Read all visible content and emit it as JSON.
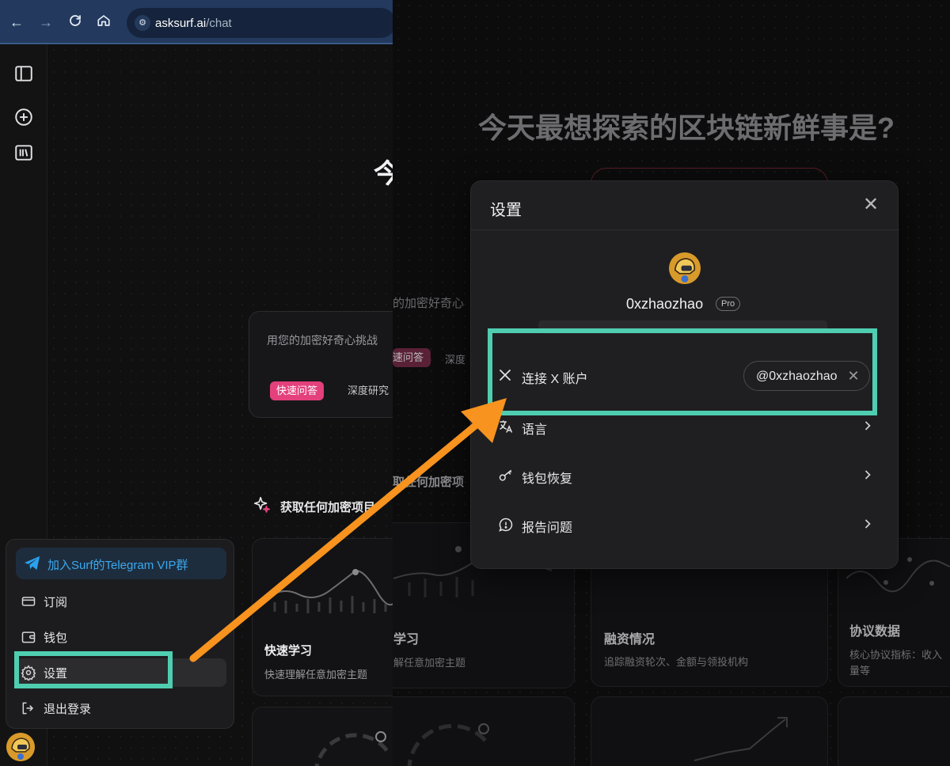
{
  "browser": {
    "url_host": "asksurf.ai",
    "url_path": "/chat"
  },
  "left": {
    "title_partial": "今",
    "chat_placeholder": "用您的加密好奇心挑战",
    "modes": {
      "fast": "快速问答",
      "deep": "深度研究"
    },
    "explore_heading": "获取任何加密项目",
    "cards": [
      {
        "title": "快速学习",
        "desc": "快速理解任意加密主题"
      }
    ],
    "menu": {
      "telegram": "加入Surf的Telegram VIP群",
      "items": [
        {
          "label": "订阅",
          "icon": "card-icon"
        },
        {
          "label": "钱包",
          "icon": "wallet-icon"
        },
        {
          "label": "设置",
          "icon": "gear-icon"
        },
        {
          "label": "退出登录",
          "icon": "logout-icon"
        }
      ]
    }
  },
  "right": {
    "page_title": "今天最想探索的区块链新鲜事是?",
    "chat_placeholder": "的加密好奇心",
    "modes": {
      "fast": "速问答",
      "deep": "深度"
    },
    "explore_heading": "取任何加密项",
    "cards": [
      {
        "title": "学习",
        "desc": "解任意加密主题"
      },
      {
        "title": "融资情况",
        "desc": "追踪融资轮次、金额与领投机构"
      },
      {
        "title": "协议数据",
        "desc": "核心协议指标：收入",
        "desc2": "量等"
      }
    ],
    "modal": {
      "title": "设置",
      "username": "0xzhaozhao",
      "badge": "Pro",
      "rows": [
        {
          "label": "连接 X 账户",
          "icon": "x-logo-icon",
          "value": "@0xzhaozhao"
        },
        {
          "label": "语言",
          "icon": "translate-icon"
        },
        {
          "label": "钱包恢复",
          "icon": "key-icon"
        },
        {
          "label": "报告问题",
          "icon": "report-icon"
        }
      ]
    }
  },
  "annotation": {
    "highlight_color": "#4fcdb0",
    "arrow_color": "#f7931e"
  }
}
